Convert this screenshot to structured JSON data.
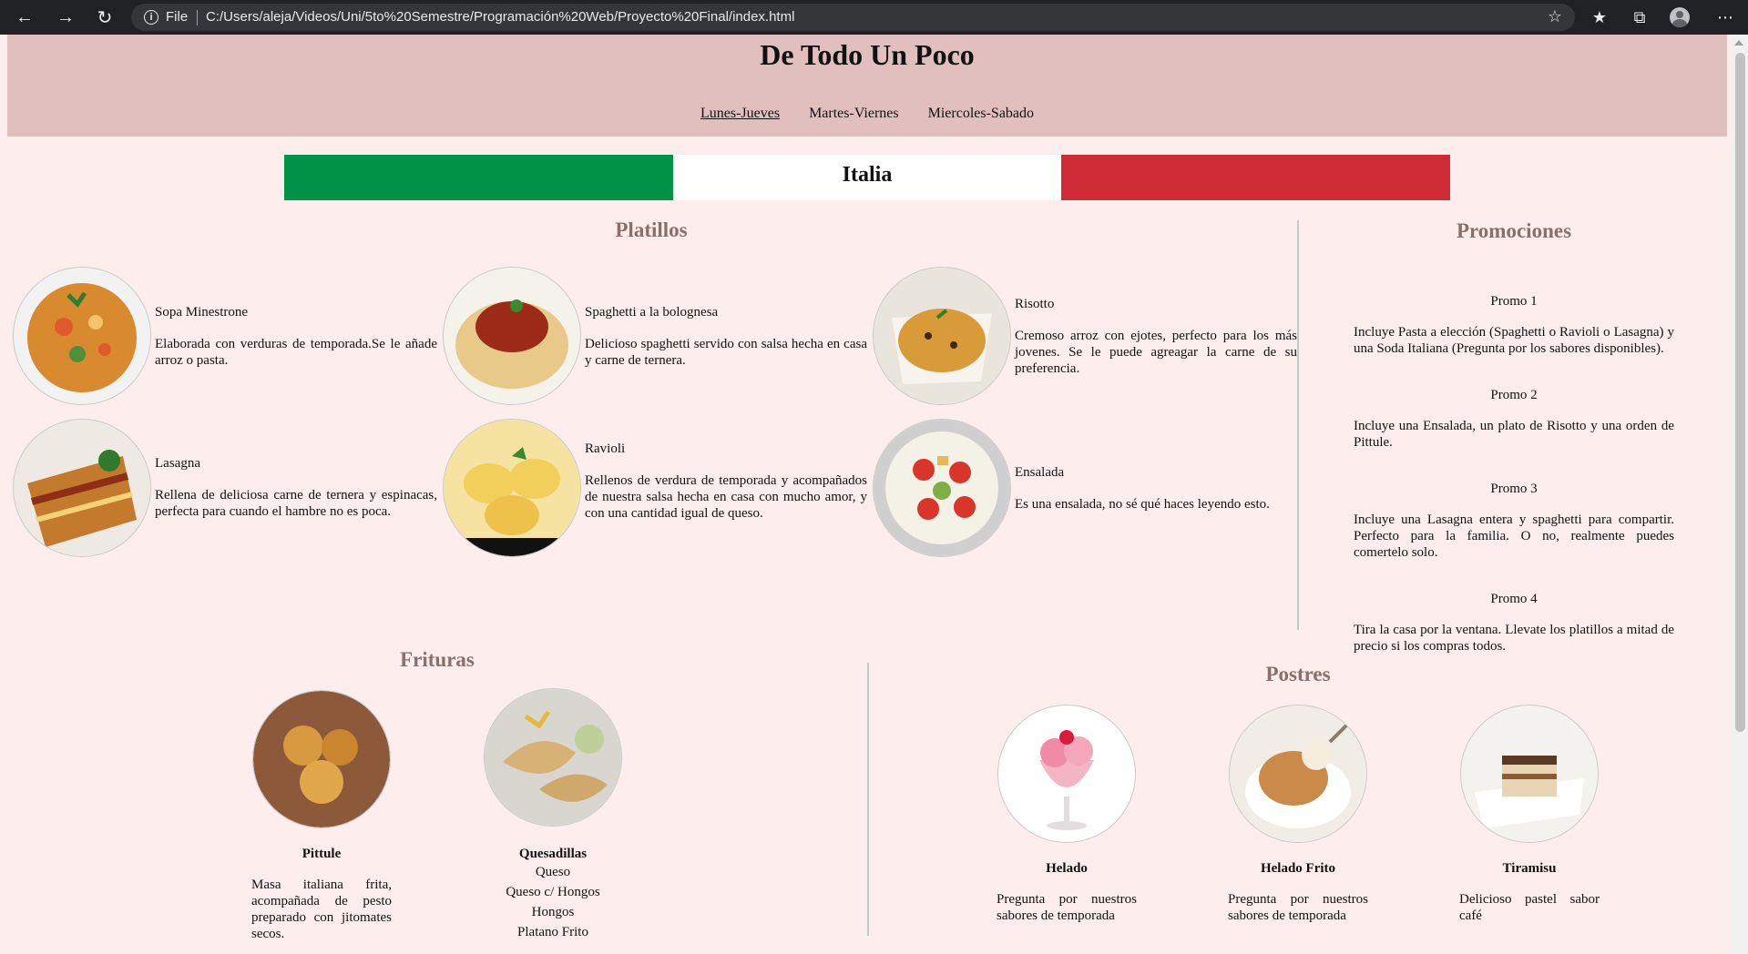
{
  "browser": {
    "file_label": "File",
    "url": "C:/Users/aleja/Videos/Uni/5to%20Semestre/Programación%20Web/Proyecto%20Final/index.html"
  },
  "site": {
    "title": "De Todo Un Poco",
    "menu": [
      "Lunes-Jueves",
      "Martes-Viernes",
      "Miercoles-Sabado"
    ]
  },
  "flag": {
    "label": "Italia",
    "colors": [
      "#009246",
      "#ffffff",
      "#ce2b37"
    ]
  },
  "platillos": {
    "title": "Platillos",
    "items": [
      {
        "name": "Sopa Minestrone",
        "desc": "Elaborada con verduras de temporada.Se le añade arroz o pasta."
      },
      {
        "name": "Spaghetti a la bolognesa",
        "desc": "Delicioso spaghetti servido con salsa hecha en casa y carne de ternera."
      },
      {
        "name": "Risotto",
        "desc": "Cremoso arroz con ejotes, perfecto para los más jovenes. Se le puede agreagar la carne de su preferencia."
      },
      {
        "name": "Lasagna",
        "desc": "Rellena de deliciosa carne de ternera y espinacas, perfecta para cuando el hambre no es poca."
      },
      {
        "name": "Ravioli",
        "desc": "Rellenos de verdura de temporada y acompañados de nuestra salsa hecha en casa con mucho amor, y con una cantidad igual de queso."
      },
      {
        "name": "Ensalada",
        "desc": "Es una ensalada, no sé qué haces leyendo esto."
      }
    ]
  },
  "promociones": {
    "title": "Promociones",
    "items": [
      {
        "title": "Promo 1",
        "desc": "Incluye Pasta a elección (Spaghetti o Ravioli o Lasagna) y una Soda Italiana (Pregunta por los sabores disponibles)."
      },
      {
        "title": "Promo 2",
        "desc": "Incluye una Ensalada, un plato de Risotto y una orden de Pittule."
      },
      {
        "title": "Promo 3",
        "desc": "Incluye una Lasagna entera y spaghetti para compartir. Perfecto para la familia. O no, realmente puedes comertelo solo."
      },
      {
        "title": "Promo 4",
        "desc": "Tira la casa por la ventana. Llevate los platillos a mitad de precio si los compras todos."
      }
    ]
  },
  "frituras": {
    "title": "Frituras",
    "pittule": {
      "name": "Pittule",
      "desc": "Masa italiana frita, acompañada de pesto preparado con jitomates secos."
    },
    "quesadillas": {
      "name": "Quesadillas",
      "options": [
        "Queso",
        "Queso c/ Hongos",
        "Hongos",
        "Platano Frito"
      ]
    }
  },
  "postres": {
    "title": "Postres",
    "items": [
      {
        "name": "Helado",
        "desc": "Pregunta por nuestros sabores de temporada"
      },
      {
        "name": "Helado Frito",
        "desc": "Pregunta por nuestros sabores de temporada"
      },
      {
        "name": "Tiramisu",
        "desc": "Delicioso pastel sabor café"
      }
    ]
  }
}
